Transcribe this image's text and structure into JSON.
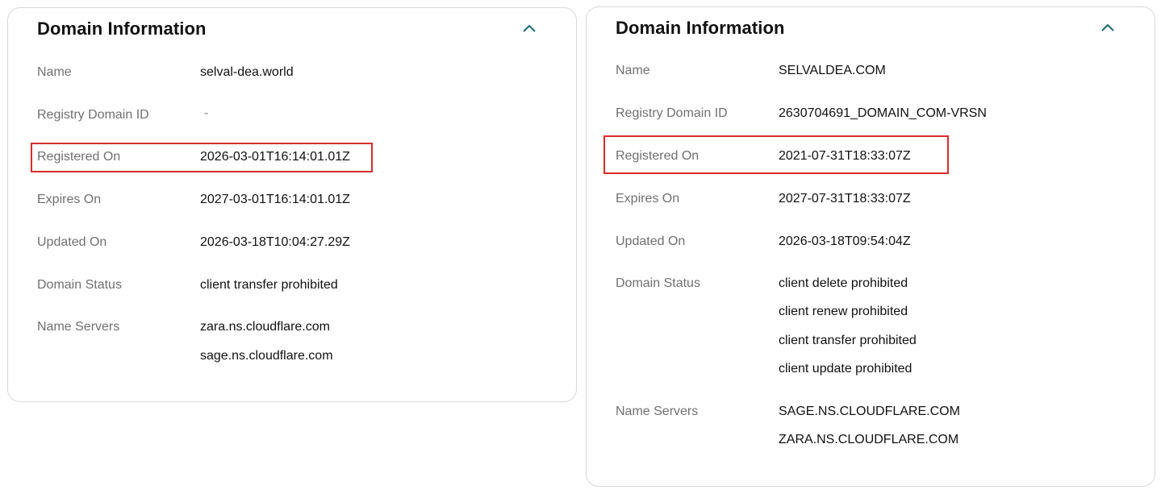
{
  "colors": {
    "highlight": "#d62c2c",
    "chevron": "#1b6b72",
    "label": "#707070",
    "value": "#111111",
    "border": "#d9d9d9"
  },
  "left": {
    "title": "Domain Information",
    "collapse_icon": "chevron-up-icon",
    "rows": {
      "name": {
        "label": "Name",
        "value": "selval-dea.world"
      },
      "registry_id": {
        "label": "Registry Domain ID",
        "value": "-"
      },
      "registered_on": {
        "label": "Registered On",
        "value": "2026-03-01T16:14:01.01Z"
      },
      "expires_on": {
        "label": "Expires On",
        "value": "2027-03-01T16:14:01.01Z"
      },
      "updated_on": {
        "label": "Updated On",
        "value": "2026-03-18T10:04:27.29Z"
      },
      "domain_status": {
        "label": "Domain Status",
        "values": [
          "client transfer prohibited"
        ]
      },
      "name_servers": {
        "label": "Name Servers",
        "values": [
          "zara.ns.cloudflare.com",
          "sage.ns.cloudflare.com"
        ]
      }
    }
  },
  "right": {
    "title": "Domain Information",
    "collapse_icon": "chevron-up-icon",
    "rows": {
      "name": {
        "label": "Name",
        "value": "SELVALDEA.COM"
      },
      "registry_id": {
        "label": "Registry Domain ID",
        "value": "2630704691_DOMAIN_COM-VRSN"
      },
      "registered_on": {
        "label": "Registered On",
        "value": "2021-07-31T18:33:07Z"
      },
      "expires_on": {
        "label": "Expires On",
        "value": "2027-07-31T18:33:07Z"
      },
      "updated_on": {
        "label": "Updated On",
        "value": "2026-03-18T09:54:04Z"
      },
      "domain_status": {
        "label": "Domain Status",
        "values": [
          "client delete prohibited",
          "client renew prohibited",
          "client transfer prohibited",
          "client update prohibited"
        ]
      },
      "name_servers": {
        "label": "Name Servers",
        "values": [
          "SAGE.NS.CLOUDFLARE.COM",
          "ZARA.NS.CLOUDFLARE.COM"
        ]
      }
    }
  }
}
